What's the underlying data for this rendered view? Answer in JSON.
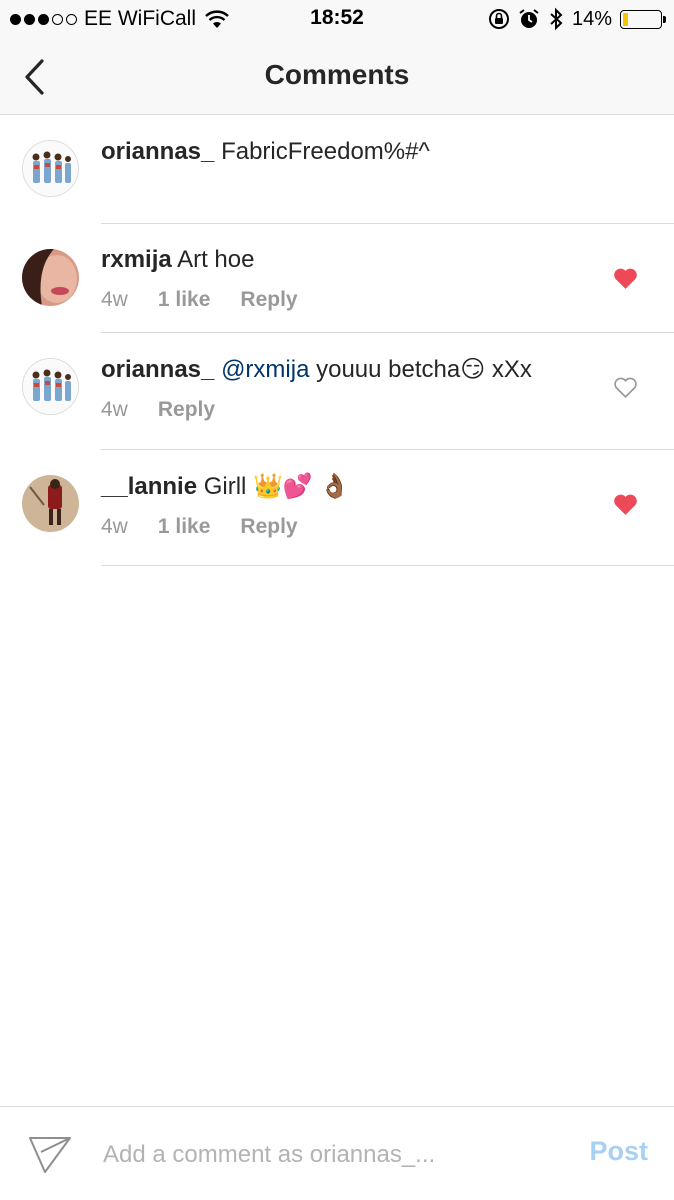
{
  "status_bar": {
    "carrier": "EE WiFiCall",
    "time": "18:52",
    "battery": "14%",
    "battery_level": 0.14,
    "icons": [
      "signal-dots-icon",
      "wifi-icon",
      "rotation-lock-icon",
      "alarm-icon",
      "bluetooth-icon",
      "battery-icon"
    ]
  },
  "nav": {
    "back_icon": "chevron-left-icon",
    "title": "Comments"
  },
  "comments": [
    {
      "username": "oriannas_",
      "text": "FabricFreedom%#^"
    },
    {
      "username": "rxmija",
      "text": "Art hoe",
      "time": "4w",
      "likes": "1 like",
      "reply": "Reply",
      "liked": true
    },
    {
      "username": "oriannas_",
      "mention": "@rxmija",
      "text": "youuu betcha😏  xXx",
      "time": "4w",
      "reply": "Reply",
      "liked": false
    },
    {
      "username": "__lannie",
      "text": "Girll 👑💕 👌🏾",
      "time": "4w",
      "likes": "1 like",
      "reply": "Reply",
      "liked": true
    }
  ],
  "input": {
    "placeholder": "Add a comment as oriannas_...",
    "value": "",
    "post_label": "Post",
    "send_icon": "paper-plane-icon"
  },
  "colors": {
    "heart_liked": "#ed4956",
    "heart_outline": "#999999",
    "mention": "#003569",
    "post_disabled": "#a7d0f5",
    "divider": "#dbdbdb"
  }
}
